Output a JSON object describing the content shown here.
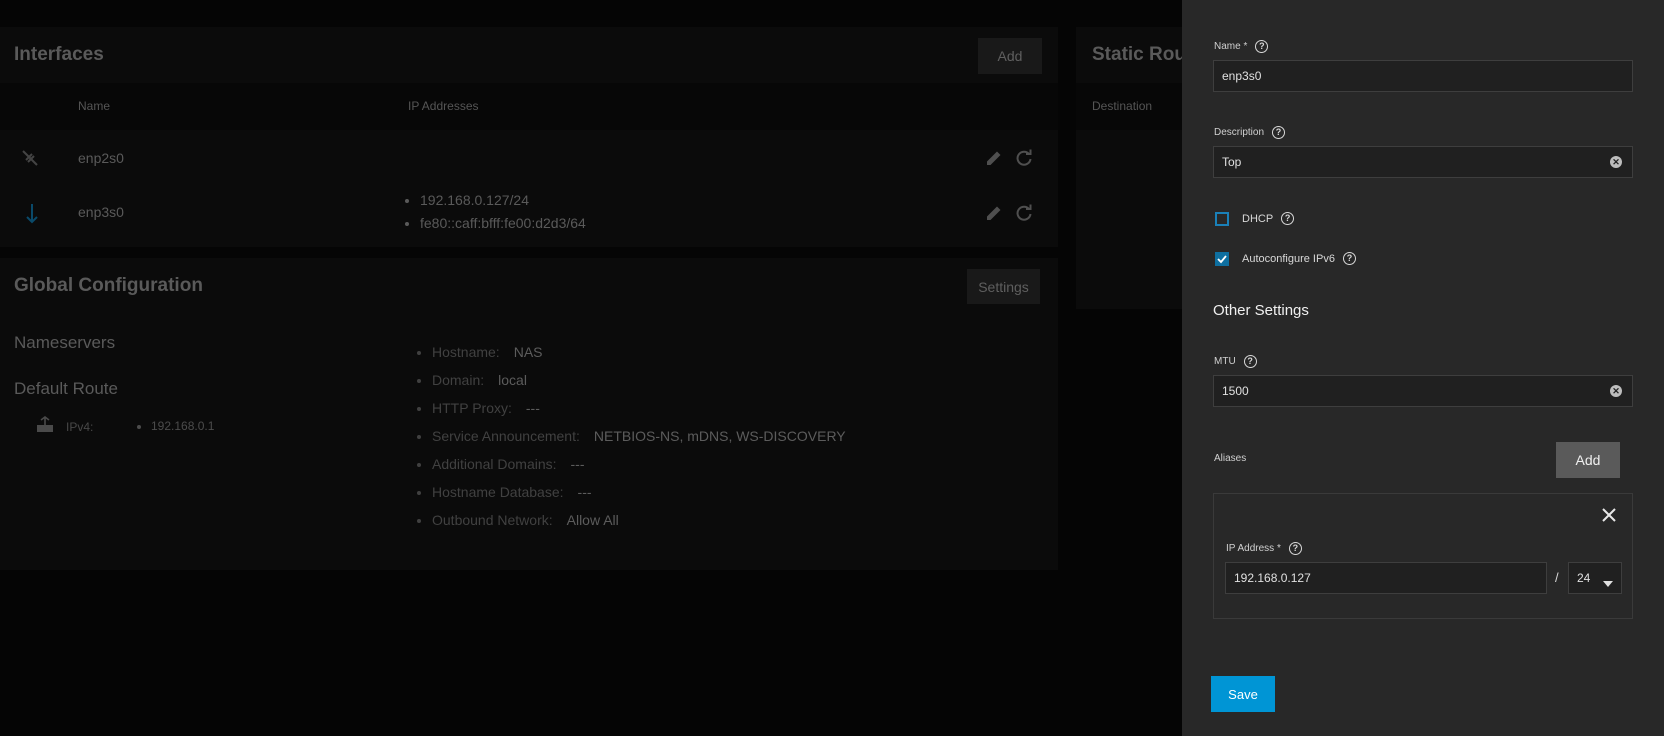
{
  "interfaces": {
    "title": "Interfaces",
    "add_label": "Add",
    "columns": [
      "Name",
      "IP Addresses"
    ],
    "rows": [
      {
        "name": "enp2s0",
        "ips": []
      },
      {
        "name": "enp3s0",
        "ips": [
          "192.168.0.127/24",
          "fe80::caff:bfff:fe00:d2d3/64"
        ]
      }
    ]
  },
  "static_routes": {
    "title": "Static Rou",
    "column": "Destination"
  },
  "global_config": {
    "title": "Global Configuration",
    "settings_label": "Settings",
    "nameservers_title": "Nameservers",
    "default_route_title": "Default Route",
    "ipv4_label": "IPv4:",
    "ipv4_value": "192.168.0.1",
    "items": [
      {
        "label": "Hostname:",
        "value": "NAS"
      },
      {
        "label": "Domain:",
        "value": "local"
      },
      {
        "label": "HTTP Proxy:",
        "value": "---"
      },
      {
        "label": "Service Announcement:",
        "value": "NETBIOS-NS, mDNS, WS-DISCOVERY"
      },
      {
        "label": "Additional Domains:",
        "value": "---"
      },
      {
        "label": "Hostname Database:",
        "value": "---"
      },
      {
        "label": "Outbound Network:",
        "value": "Allow All"
      }
    ]
  },
  "panel": {
    "name_label": "Name *",
    "name_value": "enp3s0",
    "description_label": "Description",
    "description_value": "Top",
    "dhcp_label": "DHCP",
    "dhcp_checked": false,
    "autoconf_label": "Autoconfigure IPv6",
    "autoconf_checked": true,
    "other_settings_title": "Other Settings",
    "mtu_label": "MTU",
    "mtu_value": "1500",
    "aliases_label": "Aliases",
    "aliases_add_label": "Add",
    "alias_ip_label": "IP Address *",
    "alias_ip_value": "192.168.0.127",
    "alias_separator": "/",
    "alias_mask_value": "24",
    "save_label": "Save"
  },
  "colors": {
    "accent": "#0095d5",
    "panel_bg": "#282828",
    "checkbox_checked": "#0e6fa0"
  }
}
